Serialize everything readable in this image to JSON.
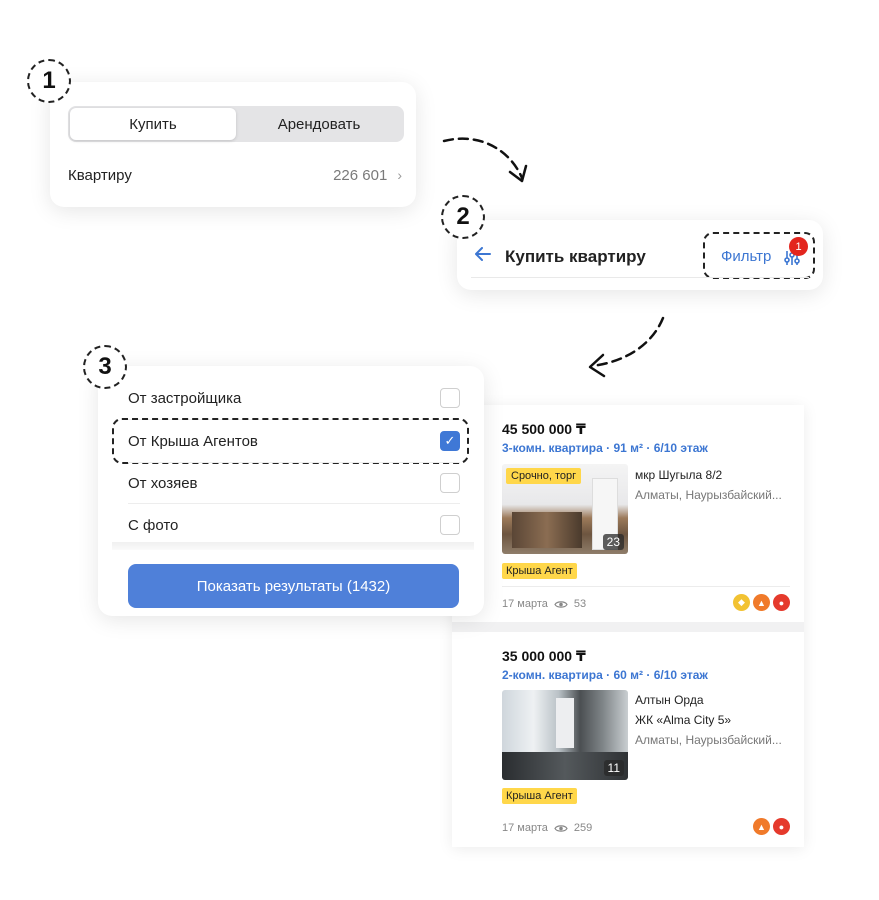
{
  "steps": [
    "1",
    "2",
    "3"
  ],
  "deal_selector": {
    "tabs": [
      {
        "label": "Купить",
        "active": true
      },
      {
        "label": "Арендовать",
        "active": false
      }
    ],
    "property_row": {
      "label": "Квартиру",
      "count": "226 601",
      "icon": "chevron-right-icon"
    }
  },
  "results_header": {
    "back_icon": "arrow-left-icon",
    "title": "Купить квартиру",
    "filter_label": "Фильтр",
    "filter_icon": "sliders-icon",
    "filter_badge": "1"
  },
  "filters": {
    "options": [
      {
        "label": "От застройщика",
        "checked": false
      },
      {
        "label": "От Крыша Агентов",
        "checked": true
      },
      {
        "label": "От хозяев",
        "checked": false
      },
      {
        "label": "С фото",
        "checked": false
      }
    ],
    "submit_label": "Показать результаты (1432)"
  },
  "listings": [
    {
      "price": "45 500 000 ₸",
      "description": "3-комн. квартира · 91 м² · 6/10 этаж",
      "photo_label": "Срочно, торг",
      "photo_count": "23",
      "address_lines": [
        "мкр Шугыла 8/2"
      ],
      "location": "Алматы, Наурызбайский...",
      "agent_badge": "Крыша Агент",
      "date": "17 марта",
      "views": "53",
      "promo_icons": [
        "tag-icon",
        "up-arrow-icon",
        "fire-icon"
      ]
    },
    {
      "price": "35 000 000 ₸",
      "description": "2-комн. квартира · 60 м² · 6/10 этаж",
      "photo_count": "11",
      "address_lines": [
        "Алтын Орда",
        "ЖК «Alma City 5»"
      ],
      "location": "Алматы, Наурызбайский...",
      "agent_badge": "Крыша Агент",
      "date": "17 марта",
      "views": "259",
      "promo_icons": [
        "up-arrow-icon",
        "fire-icon"
      ]
    }
  ],
  "colors": {
    "accent_blue": "#3c76d2",
    "button_blue": "#4f80d9",
    "badge_red": "#e3251e",
    "label_yellow": "#ffd74a"
  }
}
